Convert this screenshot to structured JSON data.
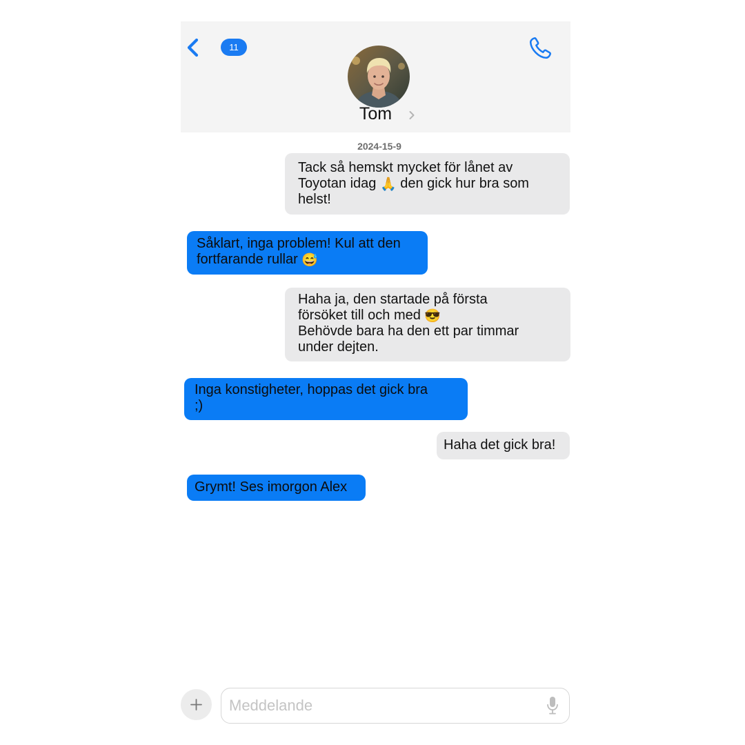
{
  "header": {
    "unread_count": "11",
    "contact_name": "Tom"
  },
  "conversation": {
    "date": "2024-15-9",
    "messages": [
      {
        "direction": "incoming",
        "parts": [
          "Tack så hemskt mycket för lånet av\nToyotan idag ",
          "🙏",
          " den gick hur bra som\nhelst!"
        ]
      },
      {
        "direction": "outgoing",
        "parts": [
          "Såklart, inga problem! Kul att den\nfortfarande rullar ",
          "😅"
        ]
      },
      {
        "direction": "incoming",
        "parts": [
          "Haha ja, den startade på första\nförsöket till och med ",
          "😎",
          "\nBehövde bara ha den ett par timmar\nunder dejten."
        ]
      },
      {
        "direction": "outgoing",
        "text": "Inga konstigheter, hoppas det gick bra\n;)"
      },
      {
        "direction": "incoming",
        "text": "Haha det gick bra!"
      },
      {
        "direction": "outgoing",
        "text": "Grymt! Ses imorgon Alex"
      }
    ]
  },
  "composer": {
    "placeholder": "Meddelande"
  },
  "icons": {
    "back": "chevron-left-icon",
    "call": "phone-icon",
    "add": "plus-icon",
    "dictation": "microphone-icon"
  },
  "colors": {
    "accent": "#0a7cf5",
    "incoming_bubble": "#e9e9ea",
    "header_background": "#f4f4f4"
  }
}
